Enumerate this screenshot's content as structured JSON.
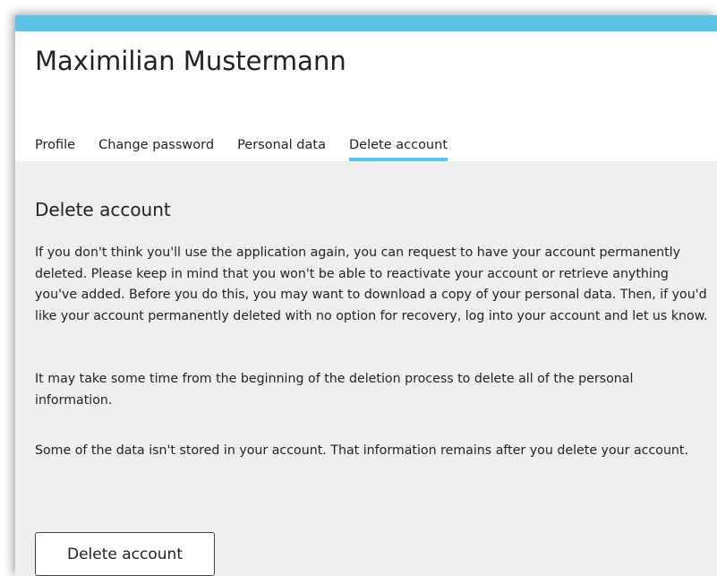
{
  "header": {
    "user_name": "Maximilian Mustermann"
  },
  "tabs": [
    {
      "label": "Profile",
      "active": false
    },
    {
      "label": "Change password",
      "active": false
    },
    {
      "label": "Personal data",
      "active": false
    },
    {
      "label": "Delete account",
      "active": true
    }
  ],
  "content": {
    "title": "Delete account",
    "paragraphs": [
      "If you don't think you'll use the application again, you can request to have your account permanently deleted. Please keep in mind that you won't be able to reactivate your account or retrieve anything you've added. Before you do this, you may want to download a copy of your personal data. Then, if you'd like your account permanently deleted with no option for recovery, log into your account and let us know.",
      "It may take some time from the beginning of the deletion process to delete all of the personal information.",
      "Some of the data isn't stored in your account. That information remains after you delete your account."
    ],
    "button_label": "Delete account"
  },
  "colors": {
    "accent": "#5ac4e6",
    "content_background": "#efefef"
  }
}
